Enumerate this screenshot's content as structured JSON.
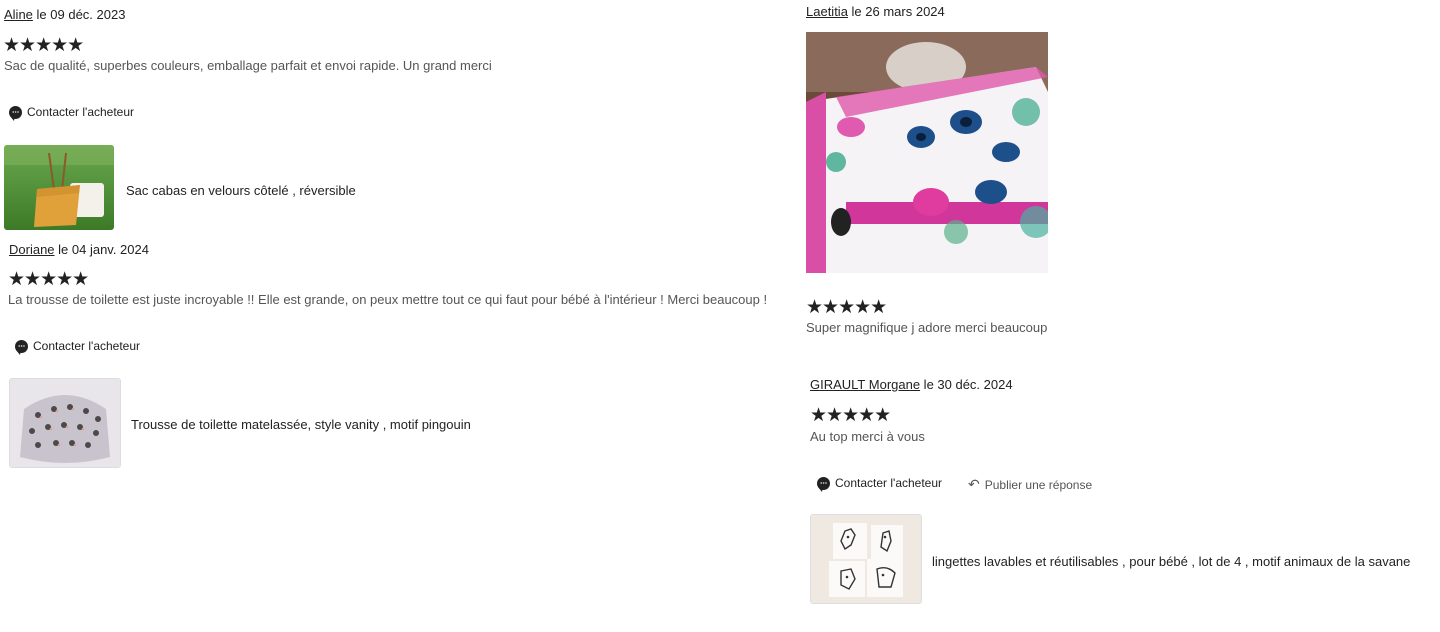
{
  "reviews": [
    {
      "reviewer": "Aline",
      "date_text": " le 09 déc. 2023",
      "stars": "★★★★★",
      "text": "Sac de qualité, superbes couleurs, emballage parfait et envoi rapide. Un grand merci",
      "contact_label": "Contacter l'acheteur",
      "product": "Sac cabas en velours côtelé , réversible"
    },
    {
      "reviewer": "Doriane",
      "date_text": " le 04 janv. 2024",
      "stars": "★★★★★",
      "text": "La trousse de toilette est juste incroyable !! Elle est grande, on peux mettre tout ce qui faut pour bébé à l'intérieur ! Merci beaucoup !",
      "contact_label": "Contacter l'acheteur",
      "product": "Trousse de toilette matelassée, style vanity , motif pingouin"
    },
    {
      "reviewer": "Laetitia",
      "date_text": " le 26 mars 2024",
      "stars": "★★★★★",
      "text": "Super magnifique j adore merci beaucoup"
    },
    {
      "reviewer": "GIRAULT Morgane",
      "date_text": " le 30 déc. 2024",
      "stars": "★★★★★",
      "text": "Au top merci à vous",
      "contact_label": "Contacter l'acheteur",
      "reply_label": "Publier une réponse",
      "product": "lingettes lavables et réutilisables , pour bébé , lot de 4 , motif animaux de la savane"
    }
  ],
  "icons": {
    "contact": "chat-bubble-icon",
    "reply": "reply-arrow-icon"
  },
  "colors": {
    "text": "#222222",
    "muted": "#555555",
    "background": "#ffffff"
  }
}
